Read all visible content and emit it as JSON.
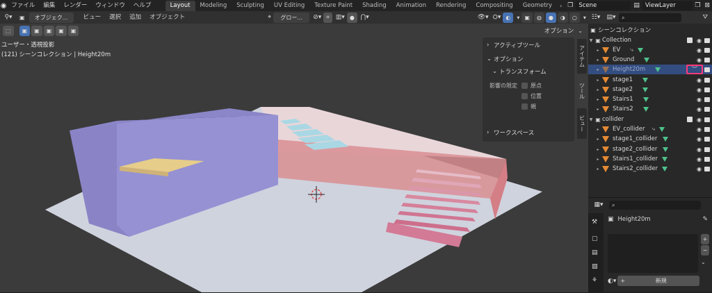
{
  "menu": {
    "items": [
      "ファイル",
      "編集",
      "レンダー",
      "ウィンドウ",
      "ヘルプ"
    ]
  },
  "workspaces": [
    "Layout",
    "Modeling",
    "Sculpting",
    "UV Editing",
    "Texture Paint",
    "Shading",
    "Animation",
    "Rendering",
    "Compositing",
    "Geometry"
  ],
  "active_workspace": "Layout",
  "scene_name": "Scene",
  "view_layer": "ViewLayer",
  "viewport": {
    "mode": "オブジェク...",
    "menus": [
      "ビュー",
      "選択",
      "追加",
      "オブジェクト"
    ],
    "transform_orientation": "グロー...",
    "options_label": "オプション",
    "view_name": "ユーザー・透視投影",
    "collection_info": "(121) シーンコレクション | Height20m"
  },
  "side_tabs": [
    "アイテム",
    "ツール",
    "ビュー"
  ],
  "npanel": {
    "active_tool": "アクティブツール",
    "options": "オプション",
    "transform": "トランスフォーム",
    "affect_only": "影響の限定",
    "origins": "原点",
    "locations": "位置",
    "parents": "親",
    "workspace": "ワークスペース"
  },
  "outliner": {
    "root": "シーンコレクション",
    "rows": [
      {
        "name": "Collection",
        "type": "collection"
      },
      {
        "name": "EV",
        "type": "object"
      },
      {
        "name": "Ground",
        "type": "object"
      },
      {
        "name": "Height20m",
        "type": "object"
      },
      {
        "name": "stage1",
        "type": "object"
      },
      {
        "name": "stage2",
        "type": "object"
      },
      {
        "name": "Stairs1",
        "type": "object"
      },
      {
        "name": "Stairs2",
        "type": "object"
      },
      {
        "name": "collider",
        "type": "collection"
      },
      {
        "name": "EV_collider",
        "type": "object"
      },
      {
        "name": "stage1_collider",
        "type": "object"
      },
      {
        "name": "stage2_collider",
        "type": "object"
      },
      {
        "name": "Stairs1_collider",
        "type": "object"
      },
      {
        "name": "Stairs2_collider",
        "type": "object"
      }
    ]
  },
  "properties": {
    "object_name": "Height20m",
    "new_button": "新規"
  },
  "colors": {
    "accent": "#4772b3",
    "highlight": "#ff3a7a",
    "object_icon": "#e58a34",
    "mesh_icon": "#4fc28b"
  }
}
